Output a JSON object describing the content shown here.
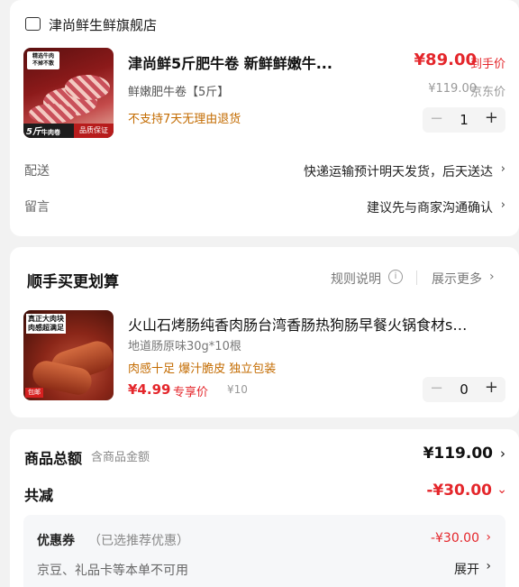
{
  "store": {
    "name": "津尚鲜生鲜旗舰店",
    "icon": "store-icon"
  },
  "product": {
    "title": "津尚鲜5斤肥牛卷 新鲜鲜嫩牛...",
    "spec": "鲜嫩肥牛卷【5斤】",
    "return_policy": "不支持7天无理由退货",
    "price": "¥89.00",
    "price_tag": "到手价",
    "orig_price": "¥119.00",
    "orig_tag": "京东价",
    "quantity": "1",
    "image_text": {
      "tag_line1": "精选牛肉",
      "tag_line2": "不掉不散",
      "weight": "5斤",
      "weight_unit": "牛肉卷",
      "guarantee": "品质保证"
    }
  },
  "delivery": {
    "label": "配送",
    "value": "快递运输预计明天发货，后天送达"
  },
  "message": {
    "label": "留言",
    "value": "建议先与商家沟通确认"
  },
  "addon": {
    "title": "顺手买更划算",
    "rule": "规则说明",
    "more": "展示更多",
    "item": {
      "title": "火山石烤肠纯香肉肠台湾香肠热狗肠早餐火锅食材s…",
      "spec": "地道肠原味30g*10根",
      "tags": "肉感十足 爆汁脆皮 独立包装",
      "price": "¥4.99",
      "price_tag": "专享价",
      "orig_price": "¥10",
      "quantity": "0",
      "image_text": {
        "line1": "真正大肉块",
        "line2": "肉感超满足",
        "corner": "包邮"
      }
    }
  },
  "summary": {
    "total_label": "商品总额",
    "total_sub": "含商品金额",
    "total_value": "¥119.00",
    "reduce_label": "共减",
    "reduce_value": "-¥30.00",
    "coupon_label": "优惠券",
    "coupon_note": "（已选推荐优惠）",
    "coupon_value": "-¥30.00",
    "jd_note": "京豆、礼品卡等本单不可用",
    "expand": "展开"
  },
  "colors": {
    "price_red": "#e4262b",
    "warning_orange": "#c36b00",
    "background": "#f2f2f2"
  }
}
